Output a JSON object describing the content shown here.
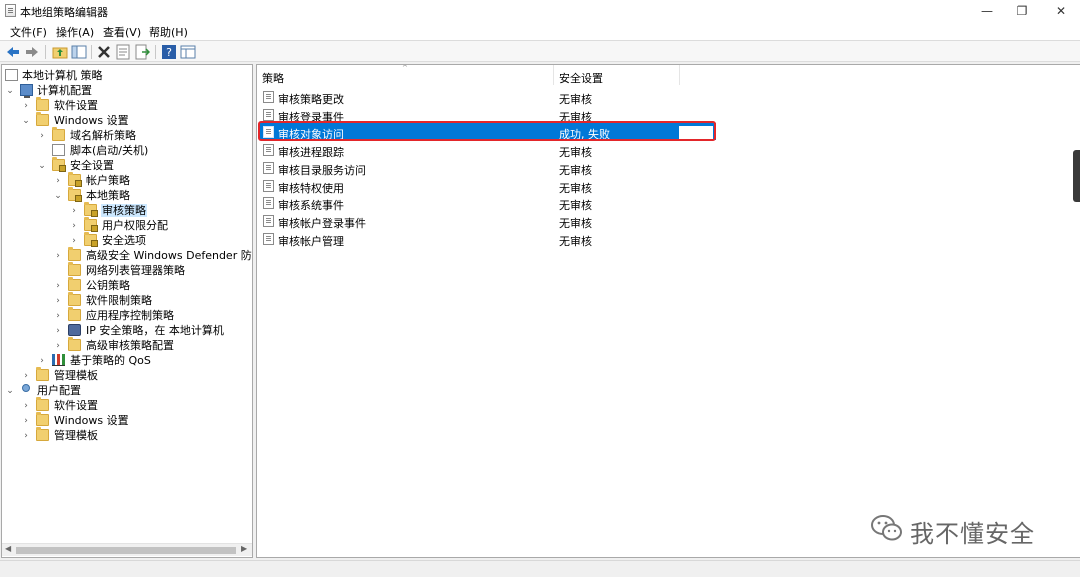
{
  "window": {
    "title": "本地组策略编辑器",
    "minimize": "—",
    "maximize": "❐",
    "close": "✕"
  },
  "menu": [
    "文件(F)",
    "操作(A)",
    "查看(V)",
    "帮助(H)"
  ],
  "toolbar": [
    "back-icon",
    "forward-icon",
    "up-folder-icon",
    "show-hide-tree-icon",
    "delete-icon",
    "properties-icon",
    "export-icon",
    "help-icon",
    "view-icon"
  ],
  "tree": [
    {
      "label": "本地计算机 策略",
      "expander": ""
    },
    {
      "label": "计算机配置",
      "expander": "⌄"
    },
    {
      "label": "软件设置",
      "expander": "›"
    },
    {
      "label": "Windows 设置",
      "expander": "⌄"
    },
    {
      "label": "域名解析策略",
      "expander": "›"
    },
    {
      "label": "脚本(启动/关机)",
      "expander": ""
    },
    {
      "label": "安全设置",
      "expander": "⌄"
    },
    {
      "label": "帐户策略",
      "expander": "›"
    },
    {
      "label": "本地策略",
      "expander": "⌄"
    },
    {
      "label": "审核策略",
      "expander": "›"
    },
    {
      "label": "用户权限分配",
      "expander": "›"
    },
    {
      "label": "安全选项",
      "expander": "›"
    },
    {
      "label": "高级安全 Windows Defender 防火墙",
      "expander": "›"
    },
    {
      "label": "网络列表管理器策略",
      "expander": ""
    },
    {
      "label": "公钥策略",
      "expander": "›"
    },
    {
      "label": "软件限制策略",
      "expander": "›"
    },
    {
      "label": "应用程序控制策略",
      "expander": "›"
    },
    {
      "label": "IP 安全策略，在 本地计算机",
      "expander": "›"
    },
    {
      "label": "高级审核策略配置",
      "expander": "›"
    },
    {
      "label": "基于策略的 QoS",
      "expander": "›"
    },
    {
      "label": "管理模板",
      "expander": "›"
    },
    {
      "label": "用户配置",
      "expander": "⌄"
    },
    {
      "label": "软件设置",
      "expander": "›"
    },
    {
      "label": "Windows 设置",
      "expander": "›"
    },
    {
      "label": "管理模板",
      "expander": "›"
    }
  ],
  "list": {
    "col_policy": "策略",
    "col_setting": "安全设置",
    "rows": [
      {
        "policy": "审核策略更改",
        "setting": "无审核"
      },
      {
        "policy": "审核登录事件",
        "setting": "无审核"
      },
      {
        "policy": "审核对象访问",
        "setting": "成功, 失败"
      },
      {
        "policy": "审核进程跟踪",
        "setting": "无审核"
      },
      {
        "policy": "审核目录服务访问",
        "setting": "无审核"
      },
      {
        "policy": "审核特权使用",
        "setting": "无审核"
      },
      {
        "policy": "审核系统事件",
        "setting": "无审核"
      },
      {
        "policy": "审核帐户登录事件",
        "setting": "无审核"
      },
      {
        "policy": "审核帐户管理",
        "setting": "无审核"
      }
    ]
  },
  "watermark": "我不懂安全"
}
